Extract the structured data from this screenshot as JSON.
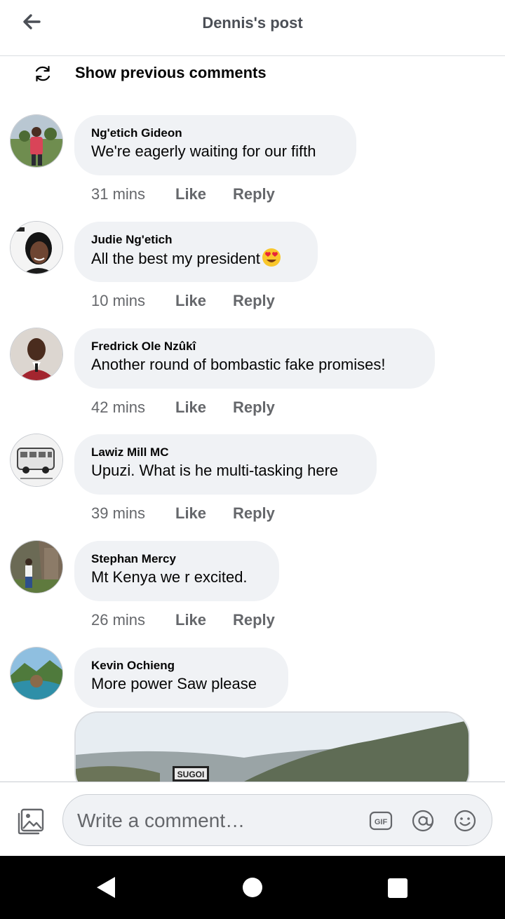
{
  "header": {
    "title": "Dennis's post",
    "back_icon": "arrow-left-icon"
  },
  "previous": {
    "label": "Show previous comments",
    "icon": "refresh-icon"
  },
  "comments": [
    {
      "author": "Ng'etich Gideon",
      "text": "We're eagerly waiting for our fifth",
      "time": "31 mins",
      "like": "Like",
      "reply": "Reply"
    },
    {
      "author": "Judie Ng'etich",
      "text": "All the best my president",
      "emoji": "heart-eyes-emoji",
      "time": "10 mins",
      "like": "Like",
      "reply": "Reply"
    },
    {
      "author": "Fredrick Ole Nzûkî",
      "text": "Another round of bombastic fake promises!",
      "time": "42 mins",
      "like": "Like",
      "reply": "Reply"
    },
    {
      "author": "Lawiz Mill MC",
      "text": "Upuzi. What is he multi-tasking here",
      "time": "39 mins",
      "like": "Like",
      "reply": "Reply"
    },
    {
      "author": "Stephan Mercy",
      "text": "Mt Kenya we r excited.",
      "time": "26 mins",
      "like": "Like",
      "reply": "Reply"
    },
    {
      "author": "Kevin Ochieng",
      "text": "More power Saw please"
    }
  ],
  "attachment": {
    "sign_text": "SUGOI"
  },
  "composer": {
    "placeholder": "Write a comment…",
    "photo_icon": "photo-icon",
    "gif_label": "GIF",
    "mention_icon": "at-sign-icon",
    "emoji_icon": "smiley-icon"
  },
  "navbar": {
    "back_icon": "nav-back-icon",
    "home_icon": "nav-home-icon",
    "recents_icon": "nav-recents-icon"
  },
  "colors": {
    "bubble": "#f0f2f5",
    "meta": "#65676b",
    "text": "#050505",
    "header_title": "#4b4f56"
  }
}
